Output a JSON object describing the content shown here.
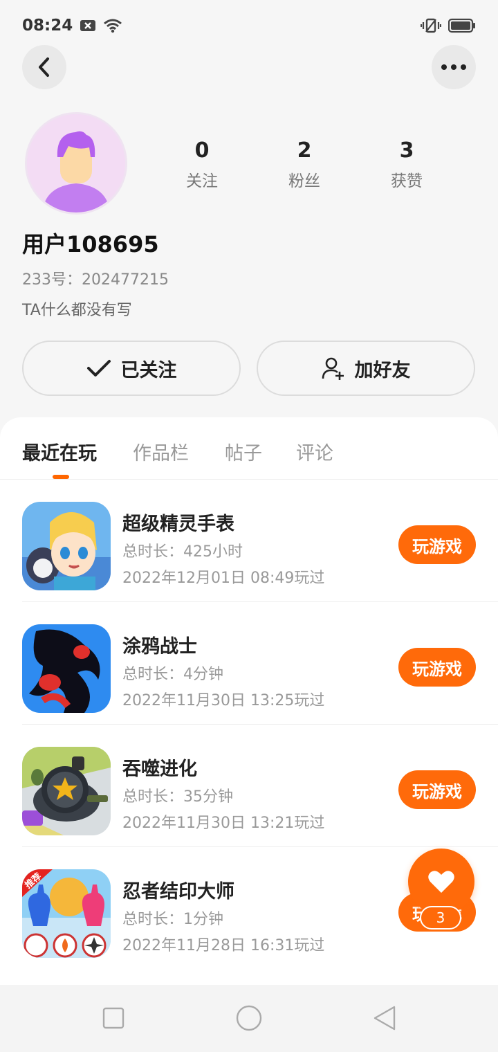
{
  "status_bar": {
    "time": "08:24"
  },
  "profile": {
    "username": "用户108695",
    "user_id": "233号：202477215",
    "bio": "TA什么都没有写",
    "stats": [
      {
        "value": "0",
        "label": "关注"
      },
      {
        "value": "2",
        "label": "粉丝"
      },
      {
        "value": "3",
        "label": "获赞"
      }
    ],
    "following_label": "已关注",
    "add_friend_label": "加好友"
  },
  "tabs": [
    {
      "label": "最近在玩",
      "active": true
    },
    {
      "label": "作品栏",
      "active": false
    },
    {
      "label": "帖子",
      "active": false
    },
    {
      "label": "评论",
      "active": false
    }
  ],
  "games": [
    {
      "name": "超级精灵手表",
      "duration": "总时长：425小时",
      "last_played": "2022年12月01日 08:49玩过",
      "button": "玩游戏"
    },
    {
      "name": "涂鸦战士",
      "duration": "总时长：4分钟",
      "last_played": "2022年11月30日 13:25玩过",
      "button": "玩游戏"
    },
    {
      "name": "吞噬进化",
      "duration": "总时长：35分钟",
      "last_played": "2022年11月30日 13:21玩过",
      "button": "玩游戏"
    },
    {
      "name": "忍者结印大师",
      "duration": "总时长：1分钟",
      "last_played": "2022年11月28日 16:31玩过",
      "button": "玩游戏",
      "icon_badge": "推荐"
    }
  ],
  "fab": {
    "count": "3"
  },
  "colors": {
    "accent": "#ff6a0a",
    "background": "#f6f6f6"
  }
}
